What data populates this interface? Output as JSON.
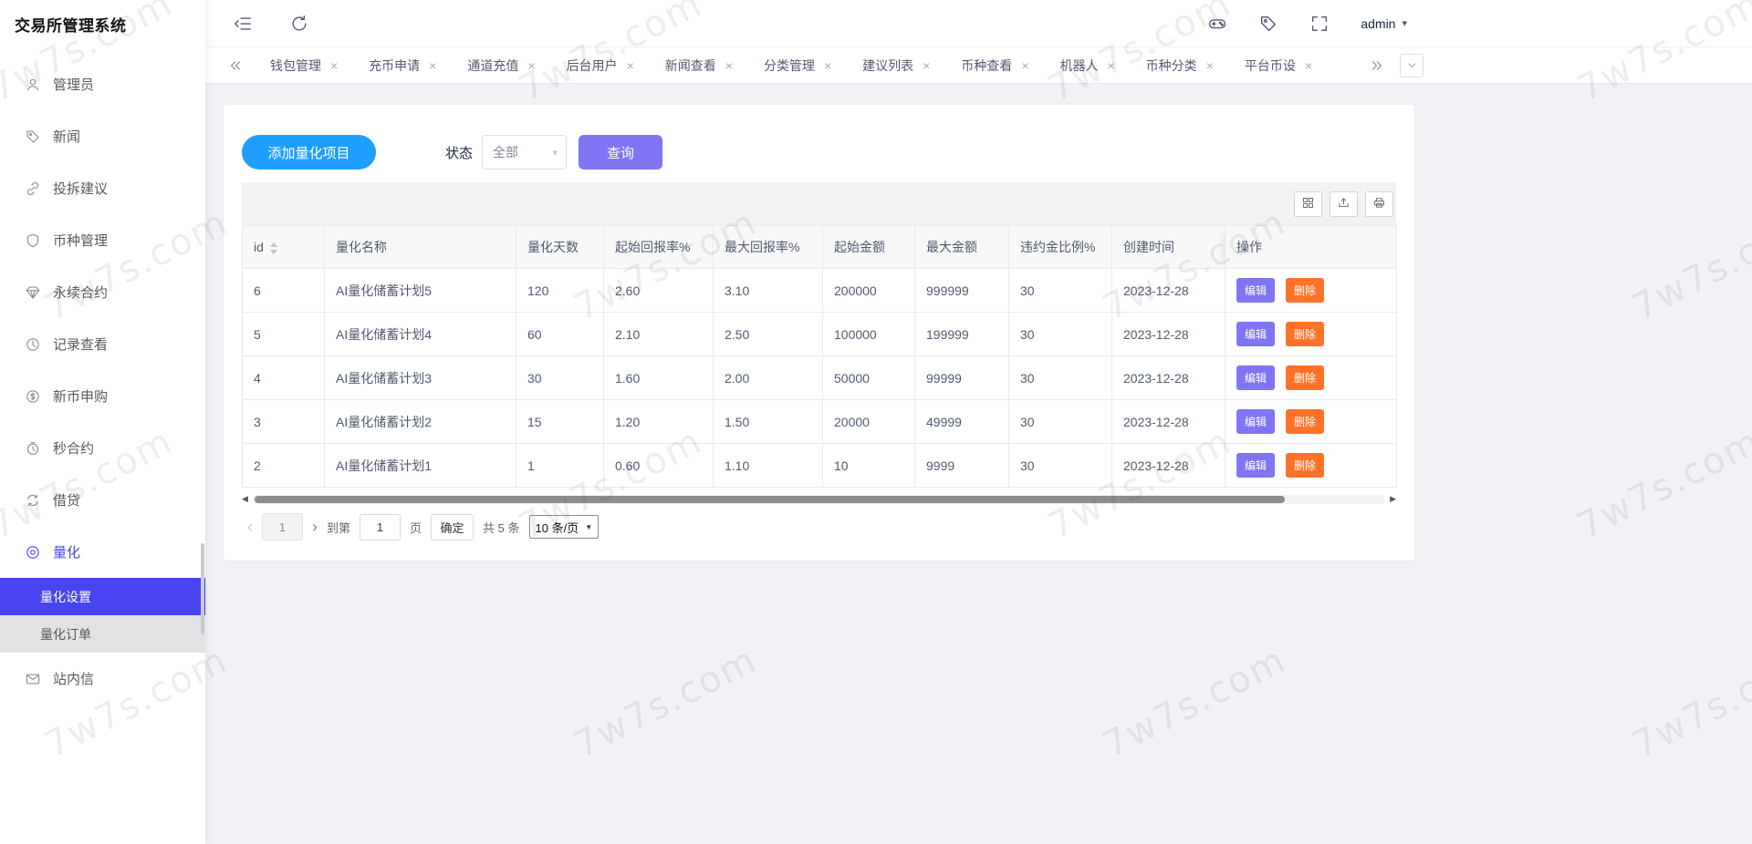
{
  "app": {
    "title": "交易所管理系统",
    "watermark": "7w7s.com"
  },
  "topbar": {
    "user": "admin"
  },
  "sidebar": {
    "items": [
      {
        "key": "admin",
        "label": "管理员",
        "icon": "user-icon"
      },
      {
        "key": "news",
        "label": "新闻",
        "icon": "tag-icon"
      },
      {
        "key": "suggest",
        "label": "投拆建议",
        "icon": "link-icon"
      },
      {
        "key": "currency",
        "label": "币种管理",
        "icon": "shield-icon"
      },
      {
        "key": "perpetual",
        "label": "永续合约",
        "icon": "gem-icon"
      },
      {
        "key": "records",
        "label": "记录查看",
        "icon": "history-icon"
      },
      {
        "key": "new-coin",
        "label": "新币申购",
        "icon": "dollar-icon"
      },
      {
        "key": "seconds",
        "label": "秒合约",
        "icon": "timer-icon"
      },
      {
        "key": "loan",
        "label": "借贷",
        "icon": "loan-icon"
      },
      {
        "key": "quant",
        "label": "量化",
        "icon": "target-icon",
        "active": true,
        "children": [
          {
            "key": "quant-settings",
            "label": "量化设置",
            "active": true
          },
          {
            "key": "quant-orders",
            "label": "量化订单"
          }
        ]
      },
      {
        "key": "mail",
        "label": "站内信",
        "icon": "mail-icon"
      }
    ]
  },
  "tabs": {
    "items": [
      "钱包管理",
      "充币申请",
      "通道充值",
      "后台用户",
      "新闻查看",
      "分类管理",
      "建议列表",
      "币种查看",
      "机器人",
      "币种分类",
      "平台币设"
    ]
  },
  "toolbar": {
    "add_button": "添加量化项目",
    "status_label": "状态",
    "status_value": "全部",
    "search_button": "查询"
  },
  "table": {
    "columns": [
      "id",
      "量化名称",
      "量化天数",
      "起始回报率%",
      "最大回报率%",
      "起始金额",
      "最大金额",
      "违约金比例%",
      "创建时间",
      "操作"
    ],
    "rows": [
      [
        "6",
        "AI量化储蓄计划5",
        "120",
        "2.60",
        "3.10",
        "200000",
        "999999",
        "30",
        "2023-12-28"
      ],
      [
        "5",
        "AI量化储蓄计划4",
        "60",
        "2.10",
        "2.50",
        "100000",
        "199999",
        "30",
        "2023-12-28"
      ],
      [
        "4",
        "AI量化储蓄计划3",
        "30",
        "1.60",
        "2.00",
        "50000",
        "99999",
        "30",
        "2023-12-28"
      ],
      [
        "3",
        "AI量化储蓄计划2",
        "15",
        "1.20",
        "1.50",
        "20000",
        "49999",
        "30",
        "2023-12-28"
      ],
      [
        "2",
        "AI量化储蓄计划1",
        "1",
        "0.60",
        "1.10",
        "10",
        "9999",
        "30",
        "2023-12-28"
      ]
    ],
    "edit_label": "编辑",
    "delete_label": "删除"
  },
  "pagination": {
    "current_page": "1",
    "goto_label": "到第",
    "goto_value": "1",
    "page_label": "页",
    "confirm_label": "确定",
    "total_label": "共 5 条",
    "page_size": "10 条/页"
  },
  "colors": {
    "primary_blue": "#1e9fff",
    "purple": "#8075f2",
    "orange": "#ff7228",
    "active_menu": "#4744f0"
  }
}
